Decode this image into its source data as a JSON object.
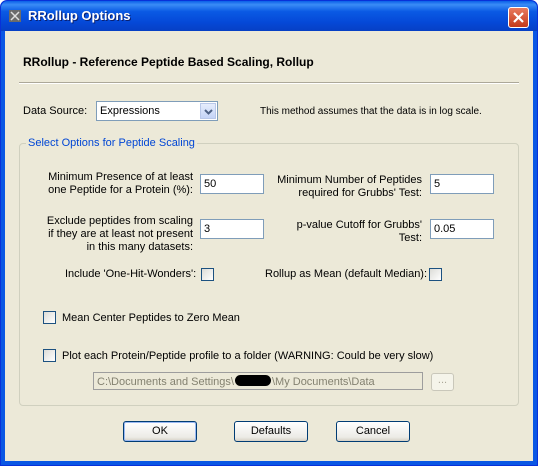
{
  "window": {
    "title": "RRollup Options",
    "icon": "rr-app-icon",
    "close_icon": "close-icon"
  },
  "header": {
    "title": "RRollup - Reference Peptide Based Scaling, Rollup"
  },
  "data_source": {
    "label": "Data Source:",
    "selected": "Expressions",
    "note": "This method assumes that the data is in log scale."
  },
  "group": {
    "title": "Select Options for Peptide Scaling",
    "min_presence": {
      "label_line1": "Minimum Presence of at least",
      "label_line2": "one Peptide for a Protein (%):",
      "value": "50"
    },
    "min_peptides": {
      "label_line1": "Minimum Number of Peptides",
      "label_line2": "required for Grubbs' Test:",
      "value": "5"
    },
    "exclude": {
      "label_line1": "Exclude peptides from scaling",
      "label_line2": "if they are at least not present",
      "label_line3": "in this many datasets:",
      "value": "3"
    },
    "pvalue": {
      "label_line1": "p-value Cutoff for Grubbs'",
      "label_line2": "Test:",
      "value": "0.05"
    },
    "one_hit": {
      "label": "Include 'One-Hit-Wonders':",
      "checked": false
    },
    "rollup_mean": {
      "label": "Rollup as Mean (default Median):",
      "checked": false
    },
    "mean_center": {
      "label": "Mean Center Peptides to Zero Mean",
      "checked": false
    },
    "plot_profile": {
      "label": "Plot each Protein/Peptide profile to a folder (WARNING: Could be very slow)",
      "checked": false
    },
    "folder_path": {
      "prefix": "C:\\Documents and Settings\\",
      "suffix": "\\My Documents\\Data"
    },
    "browse_label": "..."
  },
  "buttons": {
    "ok": "OK",
    "defaults": "Defaults",
    "cancel": "Cancel"
  }
}
